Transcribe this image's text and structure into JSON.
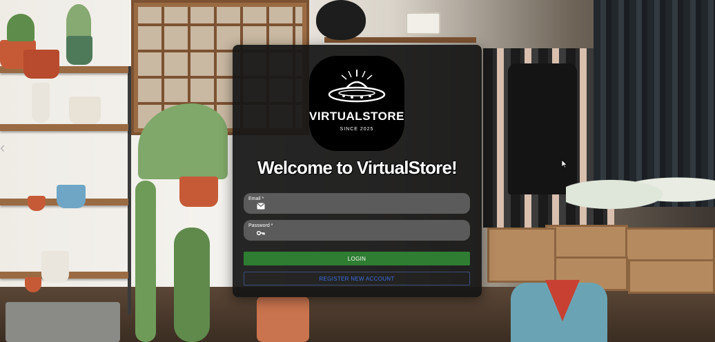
{
  "logo": {
    "name": "VIRTUALSTORE",
    "tagline": "SINCE 2025",
    "icon": "ufo-icon"
  },
  "welcome_title": "Welcome to VirtualStore!",
  "form": {
    "email": {
      "label": "Email *",
      "value": "",
      "icon": "mail-icon"
    },
    "password": {
      "label": "Password *",
      "value": "",
      "icon": "key-icon"
    },
    "login_label": "LOGIN",
    "register_label": "REGISTER NEW ACCOUNT"
  },
  "colors": {
    "card_background": "#161616",
    "field_background": "#5b5b5b",
    "login_button": "#2e7d32",
    "register_text": "#3b6fe0"
  }
}
